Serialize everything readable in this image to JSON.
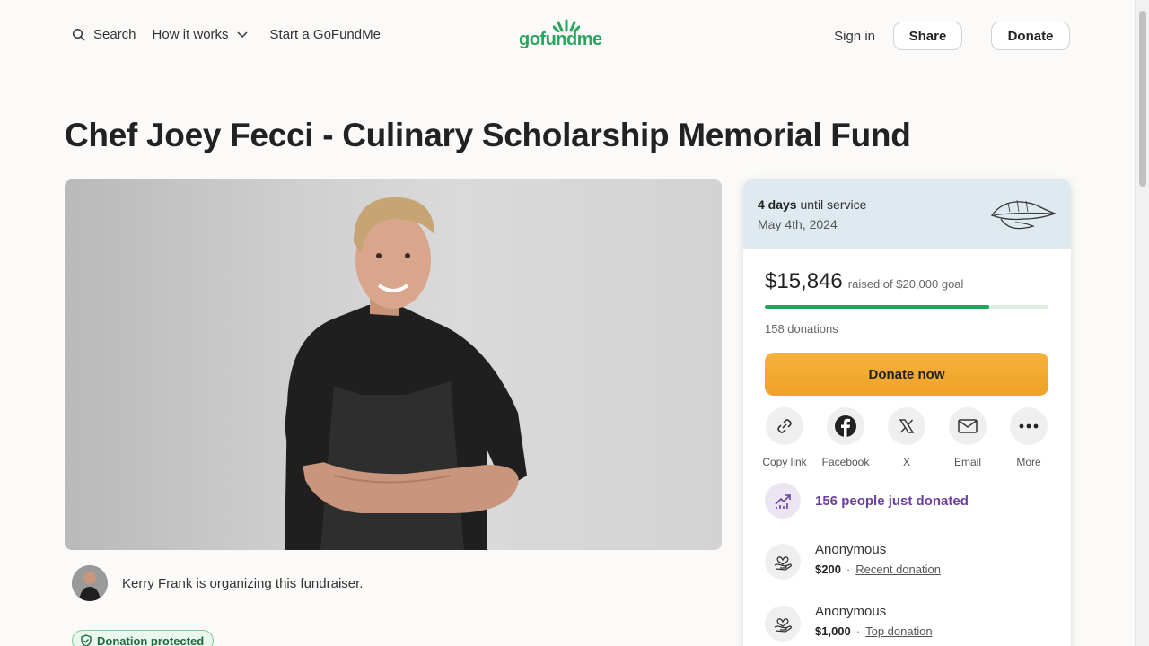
{
  "header": {
    "search_label": "Search",
    "how_label": "How it works",
    "start_label": "Start a GoFundMe",
    "logo_text": "gofundme",
    "signin_label": "Sign in",
    "share_label": "Share",
    "donate_label": "Donate"
  },
  "page": {
    "title": "Chef Joey Fecci - Culinary Scholarship Memorial Fund"
  },
  "organizer": {
    "text": "Kerry Frank is organizing this fundraiser.",
    "protected_label": "Donation protected"
  },
  "card": {
    "service_days": "4 days",
    "service_suffix": "until service",
    "service_date": "May 4th, 2024",
    "raised": "$15,846",
    "goal_text": "raised of $20,000 goal",
    "progress": 0.7923,
    "donations": "158 donations",
    "donate_now": "Donate now",
    "shares": [
      {
        "label": "Copy link",
        "icon": "link-icon"
      },
      {
        "label": "Facebook",
        "icon": "facebook-icon"
      },
      {
        "label": "X",
        "icon": "x-icon"
      },
      {
        "label": "Email",
        "icon": "email-icon"
      },
      {
        "label": "More",
        "icon": "more-icon"
      }
    ],
    "just_donated": "156 people just donated",
    "donors": [
      {
        "name": "Anonymous",
        "amount": "$200",
        "tag": "Recent donation"
      },
      {
        "name": "Anonymous",
        "amount": "$1,000",
        "tag": "Top donation"
      }
    ]
  },
  "colors": {
    "brand_green": "#2aa560",
    "donate_orange": "#f0a128",
    "purple": "#6b3fa0"
  }
}
